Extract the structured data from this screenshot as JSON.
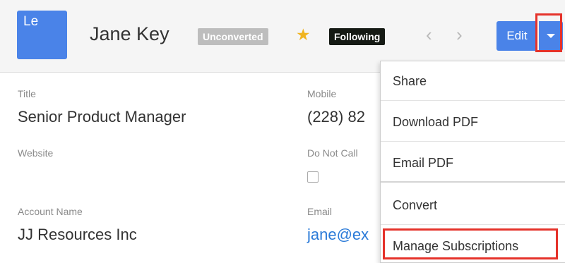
{
  "header": {
    "avatar_text": "Le",
    "record_name": "Jane Key",
    "status_badge": "Unconverted",
    "following_badge": "Following",
    "star_icon": "star-icon",
    "prev_icon": "chevron-left-icon",
    "next_icon": "chevron-right-icon",
    "edit_label": "Edit",
    "actions_icon": "caret-down-icon"
  },
  "fields": {
    "title": {
      "label": "Title",
      "value": "Senior Product Manager"
    },
    "mobile": {
      "label": "Mobile",
      "value": "(228) 82"
    },
    "website": {
      "label": "Website",
      "value": ""
    },
    "do_not_call": {
      "label": "Do Not Call",
      "checked": false
    },
    "account_name": {
      "label": "Account Name",
      "value": "JJ Resources Inc"
    },
    "email": {
      "label": "Email",
      "value": "jane@ex"
    }
  },
  "menu": {
    "items": [
      {
        "label": "Share"
      },
      {
        "label": "Download PDF"
      },
      {
        "label": "Email PDF"
      },
      {
        "label": "Convert"
      },
      {
        "label": "Manage Subscriptions"
      }
    ]
  },
  "colors": {
    "accent": "#4a83e8",
    "highlight": "#e5322a",
    "star": "#f0b420",
    "link": "#2a7ad8",
    "following_bg": "#151a14",
    "unconverted_bg": "#bdbdbd"
  }
}
